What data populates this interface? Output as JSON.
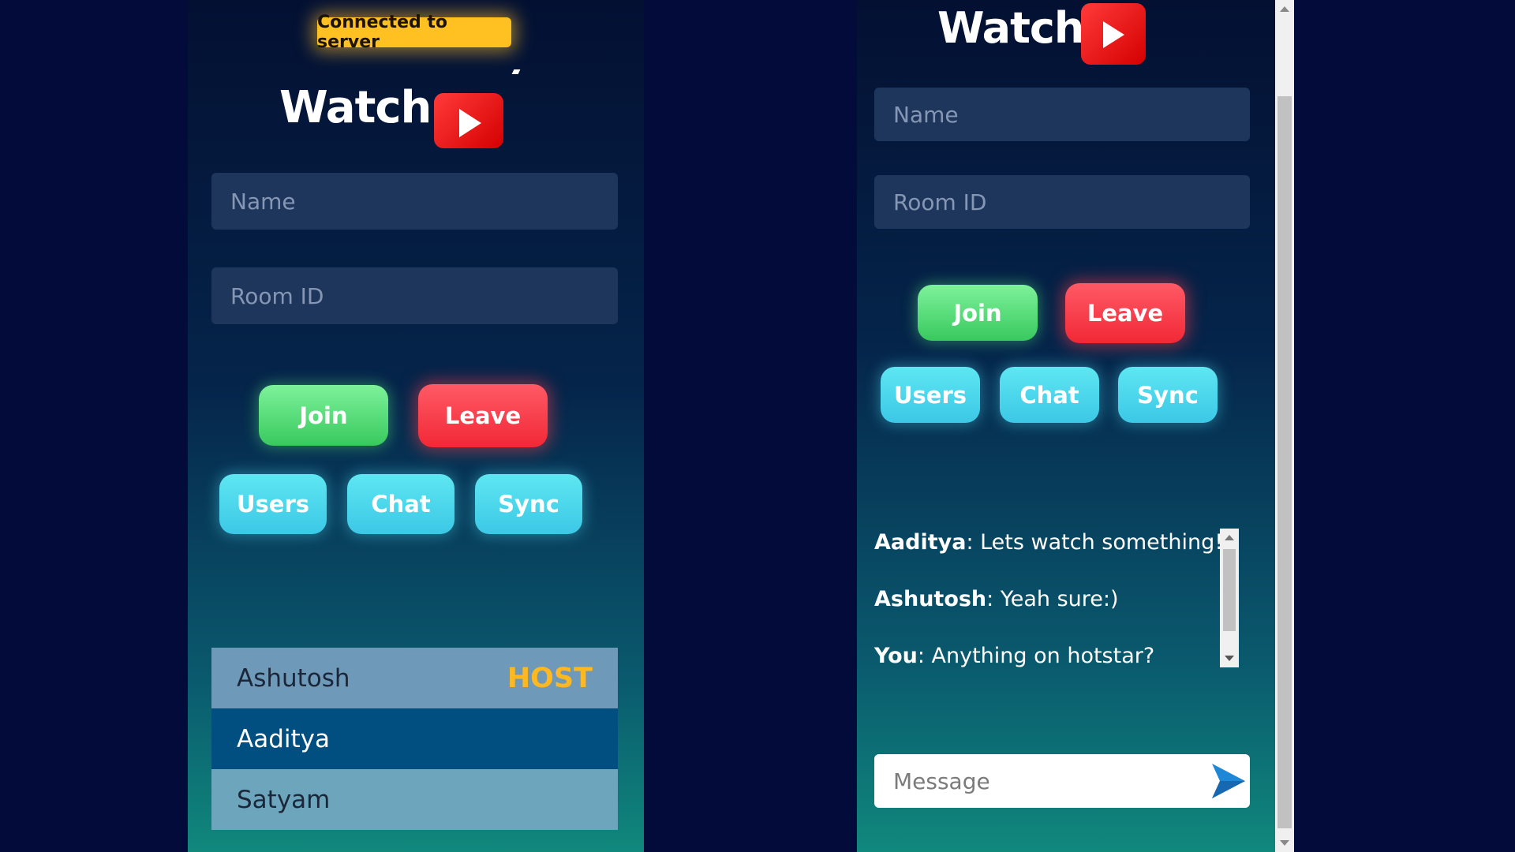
{
  "left": {
    "status_badge": "Connected to server",
    "title": "Watch",
    "name_placeholder": "Name",
    "room_placeholder": "Room ID",
    "buttons": {
      "join": "Join",
      "leave": "Leave",
      "users": "Users",
      "chat": "Chat",
      "sync": "Sync"
    },
    "users": [
      {
        "name": "Ashutosh",
        "tag": "HOST",
        "bg": "#6f99b8",
        "color": "#1b2738"
      },
      {
        "name": "Aaditya",
        "tag": "",
        "bg": "#004f80",
        "color": "#ffffff"
      },
      {
        "name": "Satyam",
        "tag": "",
        "bg": "#6da6bc",
        "color": "#1b2738"
      }
    ]
  },
  "right": {
    "title": "Watch",
    "name_placeholder": "Name",
    "room_placeholder": "Room ID",
    "buttons": {
      "join": "Join",
      "leave": "Leave",
      "users": "Users",
      "chat": "Chat",
      "sync": "Sync"
    },
    "messages": [
      {
        "sender": "Aaditya",
        "text": ": Lets watch something!"
      },
      {
        "sender": "Ashutosh",
        "text": ": Yeah sure:)"
      },
      {
        "sender": "You",
        "text": ": Anything on hotstar?"
      }
    ],
    "message_placeholder": "Message"
  },
  "colors": {
    "background": "#020b3a",
    "badge": "#ffc021",
    "join": "#38c95e",
    "leave": "#f22836",
    "cyan": "#3cc8e6",
    "host": "#ffb81f",
    "send": "#1e88d6"
  },
  "icons": {
    "logo": "play-button-icon",
    "send": "send-arrow-icon"
  }
}
